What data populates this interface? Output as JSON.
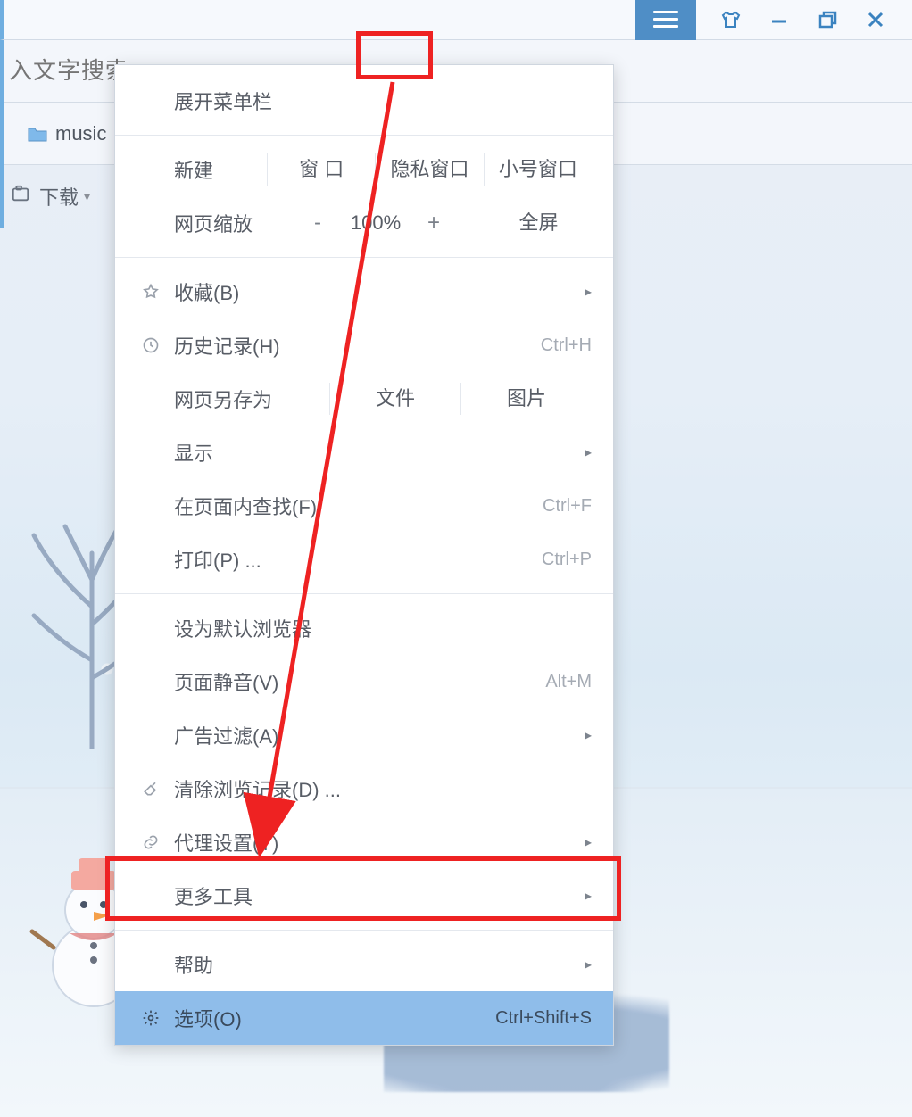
{
  "titlebar": {
    "icons": {
      "menu": "hamburger-icon",
      "skin": "skin-icon",
      "minimize": "minimize-icon",
      "maximize": "maximize-icon",
      "close": "close-icon"
    }
  },
  "search": {
    "placeholder": "入文字搜索"
  },
  "bookmark": {
    "folder_label": "music"
  },
  "toolbar": {
    "download_label": "下载"
  },
  "menu": {
    "expand_label": "展开菜单栏",
    "new_group": {
      "head": "新建",
      "window": "窗 口",
      "private": "隐私窗口",
      "alt": "小号窗口"
    },
    "zoom": {
      "head": "网页缩放",
      "minus": "-",
      "value": "100%",
      "plus": "+",
      "fullscreen": "全屏"
    },
    "favorites": {
      "label": "收藏(B)"
    },
    "history": {
      "label": "历史记录(H)",
      "shortcut": "Ctrl+H"
    },
    "saveas": {
      "head": "网页另存为",
      "file": "文件",
      "image": "图片"
    },
    "display": {
      "label": "显示"
    },
    "find": {
      "label": "在页面内查找(F)",
      "shortcut": "Ctrl+F"
    },
    "print": {
      "label": "打印(P) ...",
      "shortcut": "Ctrl+P"
    },
    "default": {
      "label": "设为默认浏览器"
    },
    "mute": {
      "label": "页面静音(V)",
      "shortcut": "Alt+M"
    },
    "adblock": {
      "label": "广告过滤(A)"
    },
    "clear": {
      "label": "清除浏览记录(D) ..."
    },
    "proxy": {
      "label": "代理设置(Y)"
    },
    "tools": {
      "label": "更多工具"
    },
    "help": {
      "label": "帮助"
    },
    "options": {
      "label": "选项(O)",
      "shortcut": "Ctrl+Shift+S"
    }
  }
}
